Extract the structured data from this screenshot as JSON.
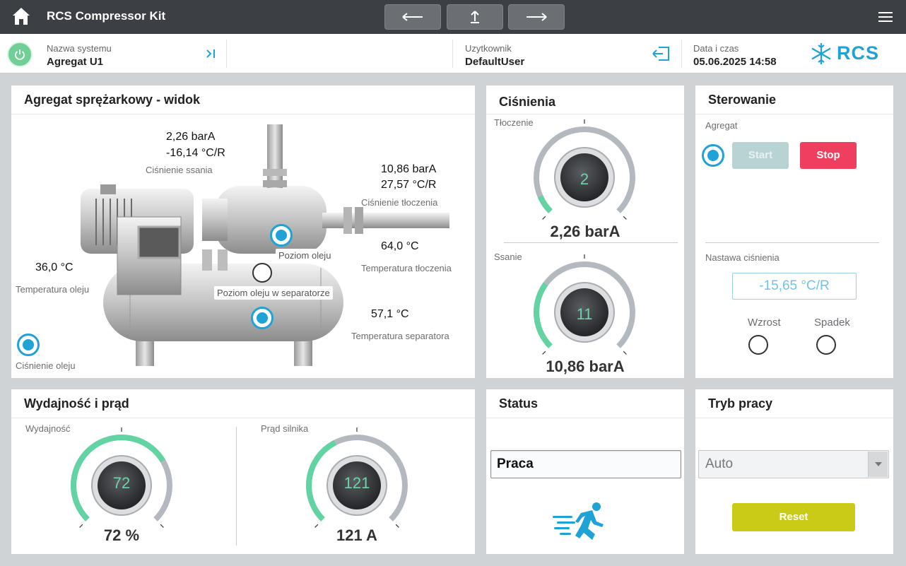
{
  "app": {
    "title": "RCS Compressor Kit"
  },
  "icons": {
    "home": "home-icon",
    "back": "arrow-left-icon",
    "up": "arrow-up-icon",
    "forward": "arrow-right-icon",
    "menu": "hamburger-menu-icon",
    "power": "power-icon",
    "expand": "expand-right-icon",
    "logout": "logout-icon",
    "logo": "snowflake-icon",
    "running": "running-person-icon"
  },
  "colors": {
    "accent": "#1fa2d6",
    "green": "#6fcf97",
    "stop": "#ef3e5e",
    "reset": "#c9cb17",
    "start_disabled": "#b8d3d4"
  },
  "infobar": {
    "system_label": "Nazwa systemu",
    "system_value": "Agregat U1",
    "user_label": "Uzytkownik",
    "user_value": "DefaultUser",
    "datetime_label": "Data i czas",
    "datetime_value": "05.06.2025 14:58",
    "logo_text": "RCS"
  },
  "unit_view": {
    "title": "Agregat sprężarkowy - widok",
    "suction_pressure": "2,26 barA",
    "suction_temp": "-16,14 °C/R",
    "suction_label": "Ciśnienie ssania",
    "discharge_pressure": "10,86 barA",
    "discharge_temp": "27,57 °C/R",
    "discharge_label": "Ciśnienie tłoczenia",
    "discharge_temperature": "64,0 °C",
    "discharge_temperature_label": "Temperatura tłoczenia",
    "oil_temperature": "36,0 °C",
    "oil_temperature_label": "Temperatura oleju",
    "separator_temperature": "57,1 °C",
    "separator_temperature_label": "Temperatura separatora",
    "oil_level_label": "Poziom oleju",
    "separator_oil_level_label": "Poziom oleju w separatorze",
    "oil_pressure_label": "Ciśnienie oleju"
  },
  "pressures": {
    "title": "Ciśnienia",
    "discharge": {
      "label": "Tłoczenie",
      "gauge_number": "2",
      "value_text": "2,26 barA",
      "fill": 0.08
    },
    "suction": {
      "label": "Ssanie",
      "gauge_number": "11",
      "value_text": "10,86 barA",
      "fill": 0.3
    }
  },
  "control": {
    "title": "Sterowanie",
    "unit_label": "Agregat",
    "start_label": "Start",
    "stop_label": "Stop",
    "setpoint_label": "Nastawa ciśnienia",
    "setpoint_value": "-15,65 °C/R",
    "increase_label": "Wzrost",
    "decrease_label": "Spadek"
  },
  "capacity": {
    "title": "Wydajność i prąd",
    "capacity": {
      "label": "Wydajność",
      "gauge_number": "72",
      "value_text": "72 %",
      "fill": 0.72
    },
    "current": {
      "label": "Prąd silnika",
      "gauge_number": "121",
      "value_text": "121 A",
      "fill": 0.4
    }
  },
  "status": {
    "title": "Status",
    "value": "Praca"
  },
  "mode": {
    "title": "Tryb pracy",
    "selected": "Auto",
    "reset_label": "Reset"
  }
}
